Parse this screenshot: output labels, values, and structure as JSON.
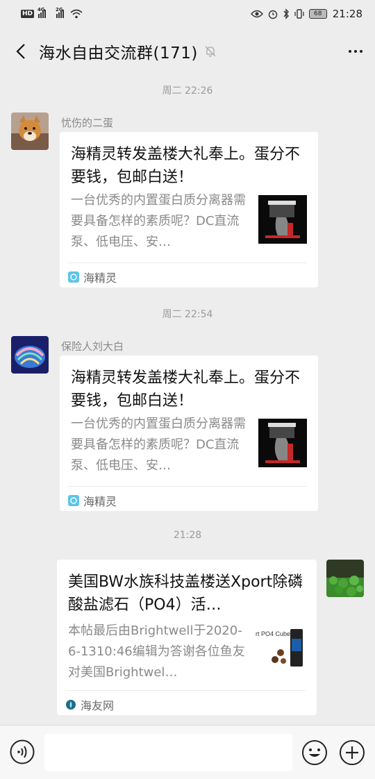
{
  "status_bar": {
    "left_tag": "HD",
    "net1": "4G",
    "net2": "2G",
    "battery": "68",
    "time": "21:28"
  },
  "header": {
    "title": "海水自由交流群(171)"
  },
  "messages": [
    {
      "timestamp": "周二 22:26",
      "sender": "忧伤的二蛋",
      "card": {
        "title": "海精灵转发盖楼大礼奉上。蛋分不要钱，包邮白送！",
        "description": "一台优秀的内置蛋白质分离器需要具备怎样的素质呢？DC直流泵、低电压、安…",
        "source": "海精灵"
      }
    },
    {
      "timestamp": "周二 22:54",
      "sender": "保险人刘大白",
      "card": {
        "title": "海精灵转发盖楼大礼奉上。蛋分不要钱，包邮白送！",
        "description": "一台优秀的内置蛋白质分离器需要具备怎样的素质呢？DC直流泵、低电压、安…",
        "source": "海精灵"
      }
    },
    {
      "timestamp": "21:28",
      "sender": "",
      "card": {
        "title": "美国BW水族科技盖楼送Xport除磷酸盐滤石（PO4）活…",
        "description": "本帖最后由Brightwell于2020-6-1310:46编辑为答谢各位鱼友对美国Brightwel…",
        "thumb_text": "rt PO4 Cubes",
        "source": "海友网"
      }
    }
  ],
  "colors": {
    "background": "#ededed",
    "card": "#ffffff",
    "muted_text": "#8a8a8a",
    "source_icon_green": "#1aad75"
  },
  "icons": [
    "back-arrow-icon",
    "mute-bell-icon",
    "more-dots-icon",
    "voice-icon",
    "emoji-icon",
    "plus-icon"
  ]
}
